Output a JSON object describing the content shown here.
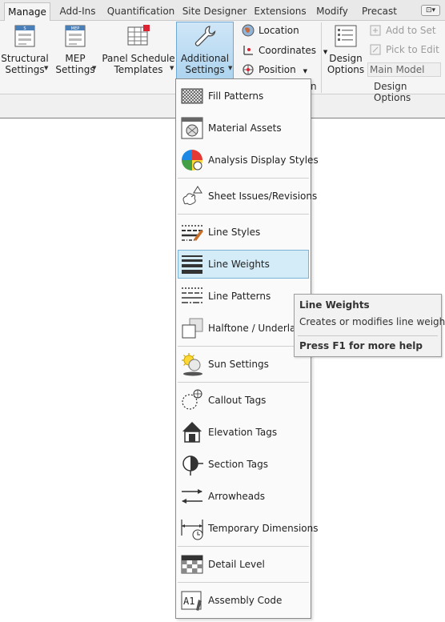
{
  "tabs": [
    "Manage",
    "Add-Ins",
    "Quantification",
    "Site Designer",
    "Extensions",
    "Modify",
    "Precast"
  ],
  "tab_options": "⊡▾",
  "ribbon": {
    "structural_settings": "Structural\nSettings",
    "mep_settings": "MEP\nSettings",
    "panel_schedule_templates": "Panel Schedule\nTemplates",
    "additional_settings": "Additional\nSettings",
    "location": "Location",
    "coordinates": "Coordinates",
    "position": "Position",
    "design_options": "Design\nOptions",
    "add_to_set": "Add to Set",
    "pick_to_edit": "Pick to Edit",
    "main_model": "Main Model",
    "design_options_panel": "Design Options",
    "partial_panel_label": "n"
  },
  "menu": {
    "items": [
      {
        "label": "Fill Patterns",
        "icon": "fill-patterns-icon"
      },
      {
        "label": "Material Assets",
        "icon": "material-assets-icon"
      },
      {
        "label": "Analysis Display Styles",
        "icon": "analysis-display-styles-icon"
      },
      {
        "label": "Sheet Issues/Revisions",
        "icon": "sheet-issues-icon"
      },
      {
        "label": "Line Styles",
        "icon": "line-styles-icon"
      },
      {
        "label": "Line Weights",
        "icon": "line-weights-icon"
      },
      {
        "label": "Line Patterns",
        "icon": "line-patterns-icon"
      },
      {
        "label": "Halftone / Underlay",
        "icon": "halftone-icon"
      },
      {
        "label": "Sun Settings",
        "icon": "sun-settings-icon"
      },
      {
        "label": "Callout Tags",
        "icon": "callout-tags-icon"
      },
      {
        "label": "Elevation Tags",
        "icon": "elevation-tags-icon"
      },
      {
        "label": "Section Tags",
        "icon": "section-tags-icon"
      },
      {
        "label": "Arrowheads",
        "icon": "arrowheads-icon"
      },
      {
        "label": "Temporary Dimensions",
        "icon": "temporary-dimensions-icon"
      },
      {
        "label": "Detail Level",
        "icon": "detail-level-icon"
      },
      {
        "label": "Assembly Code",
        "icon": "assembly-code-icon"
      }
    ]
  },
  "tooltip": {
    "title": "Line Weights",
    "description": "Creates or modifies line weights.",
    "help": "Press F1 for more help"
  },
  "colors": {
    "highlight": "#d4ecf8",
    "highlight_border": "#7bb3d6",
    "pressed": "#aed4ef"
  }
}
